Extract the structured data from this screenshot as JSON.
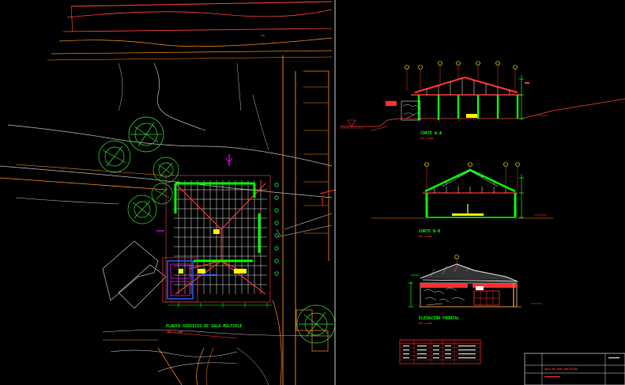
{
  "drawing": {
    "plan_title": "PLANTA SERVICIO DE SALA MÚLTIPLE",
    "plan_scale": "ESC 1:100",
    "section_a_title": "CORTE A-A",
    "section_a_scale": "ESC 1:100",
    "section_b_title": "CORTE B-B",
    "section_b_scale": "ESC 1:100",
    "elevation_title": "ELEVACIÓN FRONTAL",
    "elevation_scale": "ESC 1:100",
    "title_block": "SALA DE USOS MULTIPLES"
  },
  "colors": {
    "background": "#000000",
    "wall": "#00ff00",
    "roof": "#ff3030",
    "grid": "#ffffff",
    "topo": "#ff8c1a",
    "annotation": "#ff00ff",
    "label": "#00ff00"
  }
}
